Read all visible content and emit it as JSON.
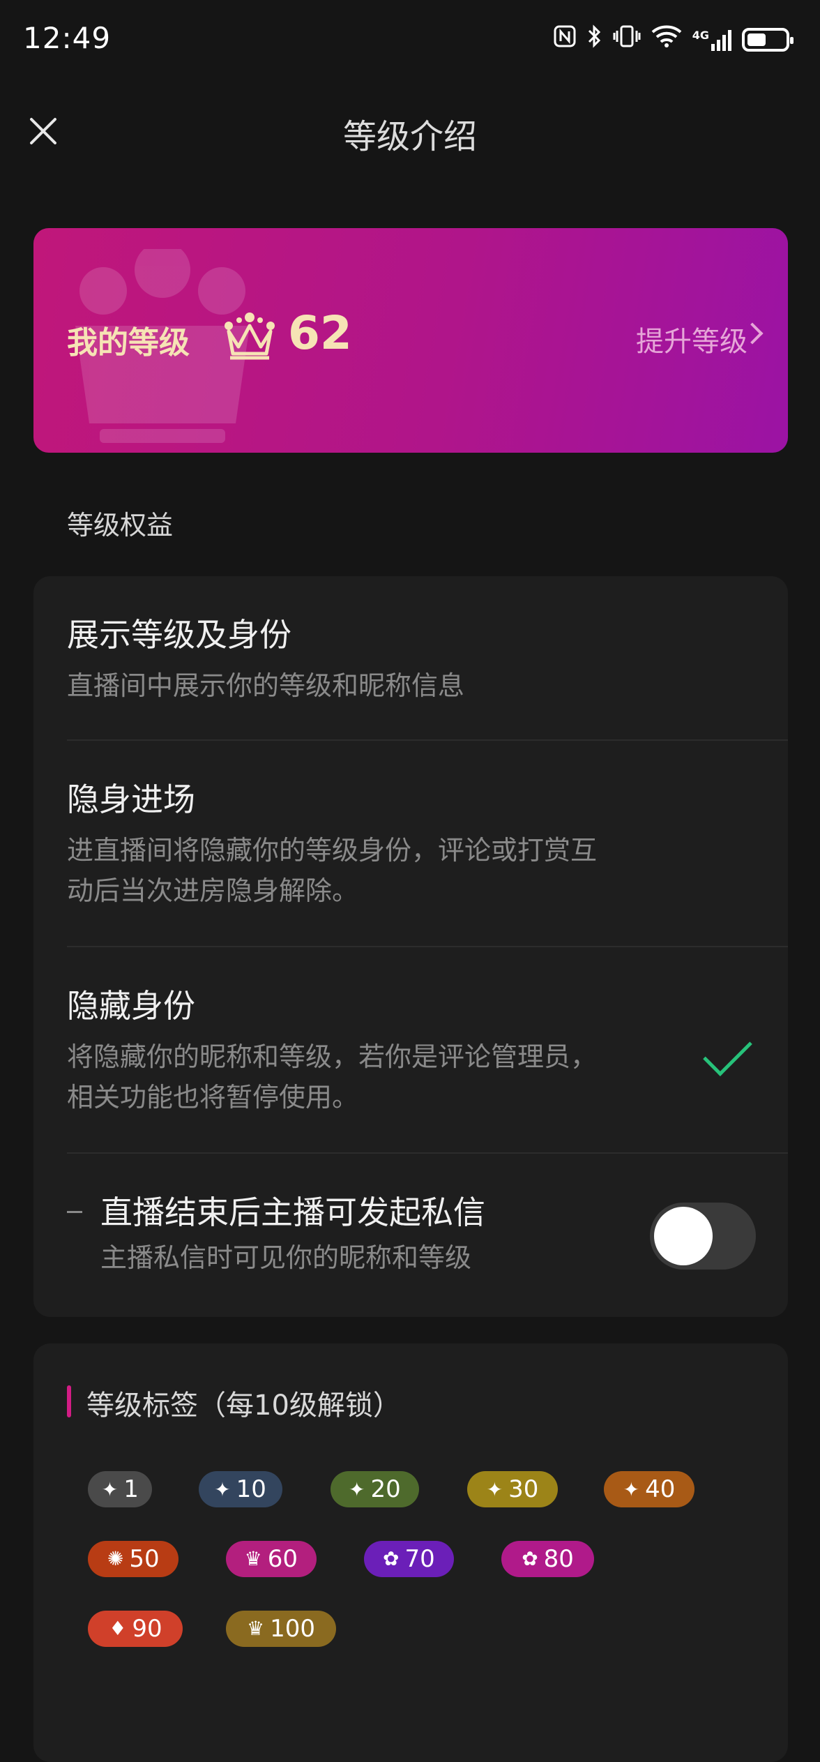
{
  "status_bar": {
    "time": "12:49",
    "icons": [
      "nfc-icon",
      "bluetooth-icon",
      "vibrate-icon",
      "wifi-icon",
      "signal-4g-icon",
      "battery-icon"
    ],
    "signal_label": "4G",
    "battery_level": 0.5
  },
  "header": {
    "title": "等级介绍"
  },
  "level_banner": {
    "label": "我的等级",
    "level": "62",
    "upgrade": "提升等级"
  },
  "rights": {
    "section_title": "等级权益",
    "items": [
      {
        "title": "展示等级及身份",
        "desc": "直播间中展示你的等级和昵称信息"
      },
      {
        "title": "隐身进场",
        "desc": "进直播间将隐藏你的等级身份，评论或打赏互动后当次进房隐身解除。"
      },
      {
        "title": "隐藏身份",
        "desc": "将隐藏你的昵称和等级，若你是评论管理员，相关功能也将暂停使用。",
        "selected": true
      },
      {
        "title": "直播结束后主播可发起私信",
        "desc": "主播私信时可见你的昵称和等级",
        "toggle_on": false
      }
    ]
  },
  "tags": {
    "title": "等级标签（每10级解锁）",
    "items": [
      {
        "label": "1",
        "color": "#4a4a4a",
        "icon": "sparkle-icon"
      },
      {
        "label": "10",
        "color": "#33455e",
        "icon": "sparkle-icon"
      },
      {
        "label": "20",
        "color": "#4e6a2c",
        "icon": "sparkle-icon"
      },
      {
        "label": "30",
        "color": "#9c8418",
        "icon": "sparkle-icon"
      },
      {
        "label": "40",
        "color": "#a85a16",
        "icon": "sparkle-icon"
      },
      {
        "label": "50",
        "color": "#b83c14",
        "icon": "sun-icon"
      },
      {
        "label": "60",
        "color": "#b31f7e",
        "icon": "crown-icon"
      },
      {
        "label": "70",
        "color": "#6b1fb8",
        "icon": "flower-icon"
      },
      {
        "label": "80",
        "color": "#b01a8a",
        "icon": "flower-icon"
      },
      {
        "label": "90",
        "color": "#d0402a",
        "icon": "diamond-icon"
      },
      {
        "label": "100",
        "color": "#8a6a20",
        "icon": "crown-icon"
      }
    ]
  }
}
